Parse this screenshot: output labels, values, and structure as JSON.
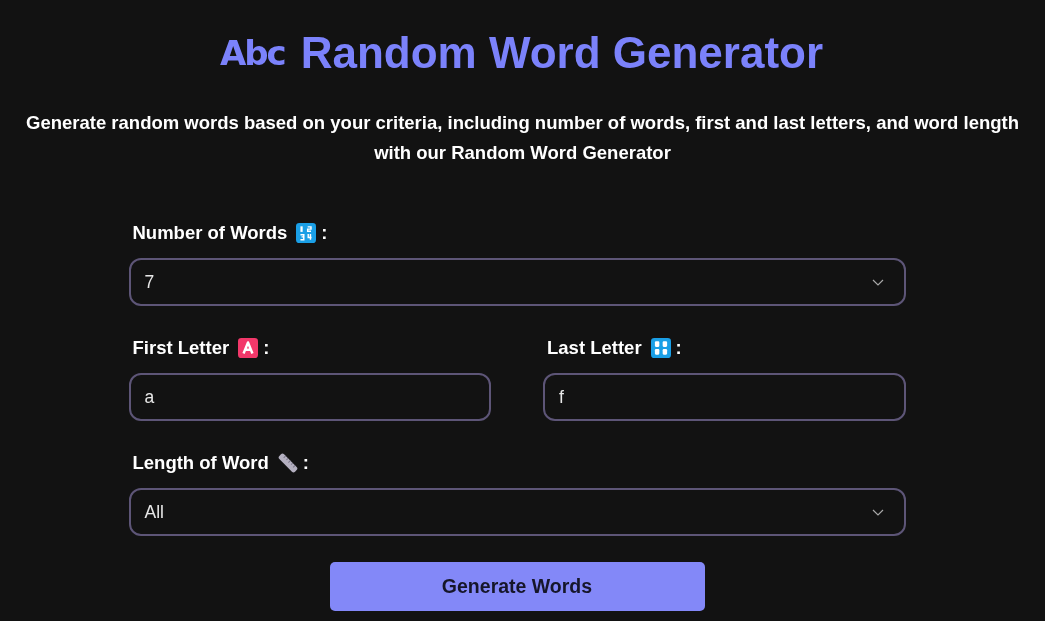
{
  "header": {
    "logo": "Abc",
    "title": "Random Word Generator",
    "subtitle": "Generate random words based on your criteria, including number of words, first and last letters, and word length with our Random Word Generator"
  },
  "form": {
    "rows": [
      {
        "fields": [
          {
            "kind": "select",
            "label": "Number of Words",
            "label_end": ":",
            "value": "7"
          }
        ]
      },
      {
        "fields": [
          {
            "kind": "text",
            "label": "First Letter",
            "label_end": ":",
            "value": "a"
          },
          {
            "kind": "text",
            "label": "Last Letter",
            "label_end": ":",
            "value": "f"
          }
        ]
      },
      {
        "fields": [
          {
            "kind": "select",
            "label": "Length of Word",
            "label_end": ":",
            "value": "All"
          }
        ]
      }
    ],
    "button": "Generate Words"
  }
}
